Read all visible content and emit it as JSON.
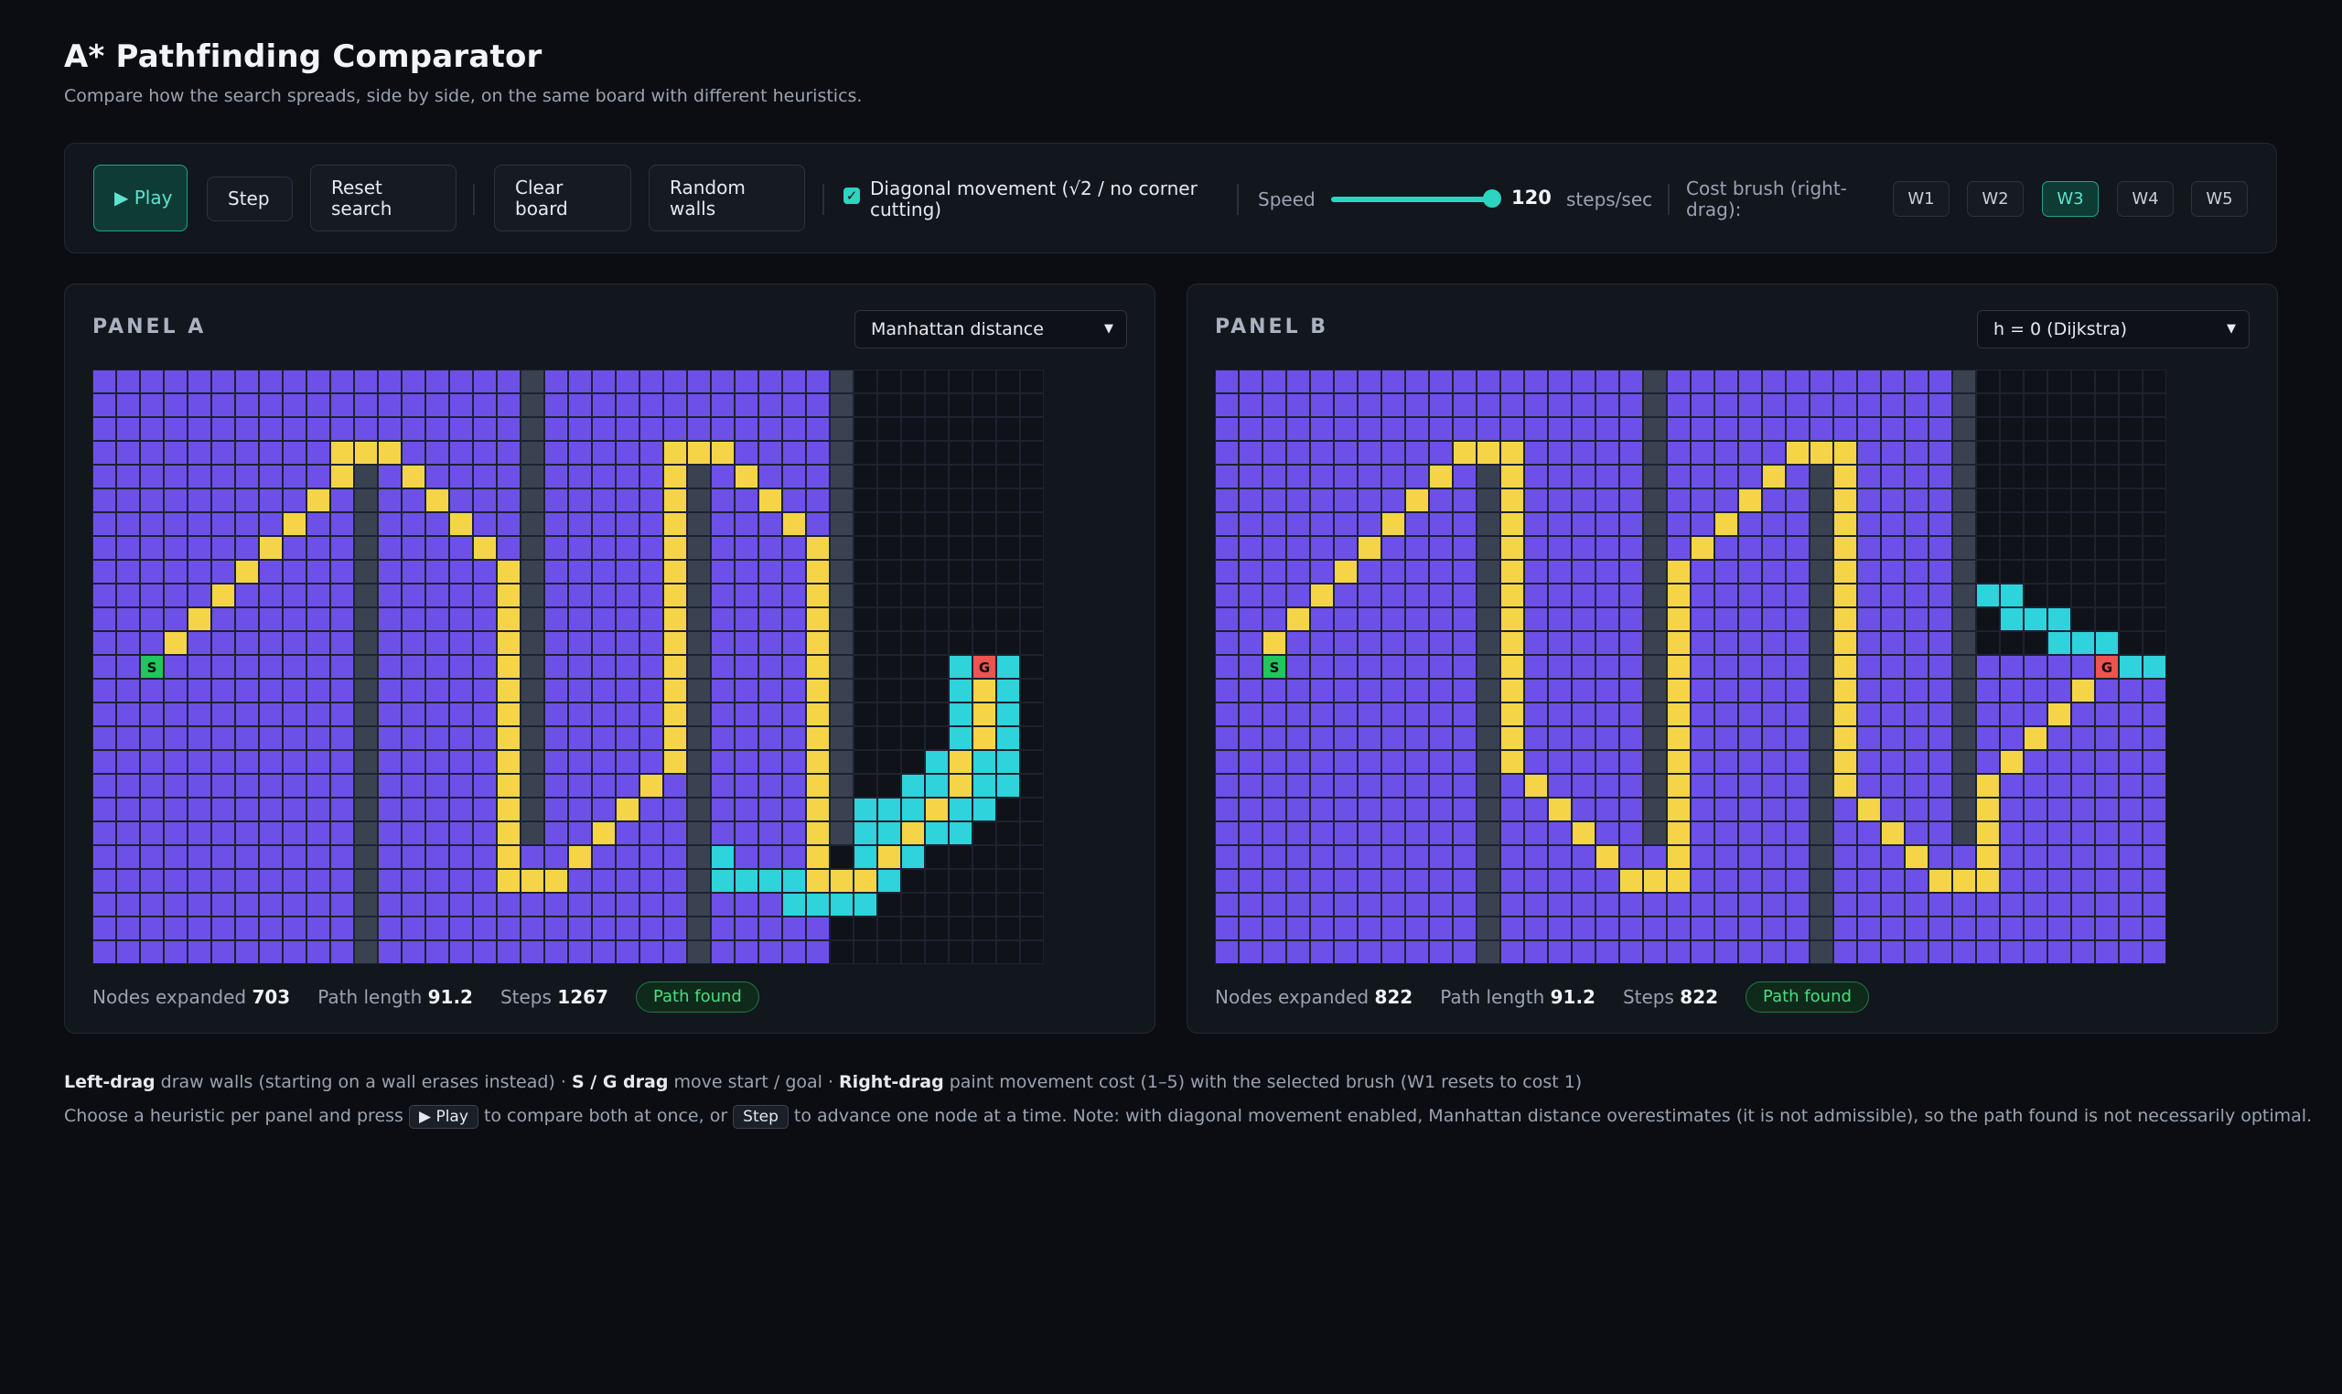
{
  "header": {
    "title": "A* Pathfinding Comparator",
    "subtitle": "Compare how the search spreads, side by side, on the same board with different heuristics."
  },
  "toolbar": {
    "play_label": "▶ Play",
    "step_label": "Step",
    "reset_label": "Reset search",
    "clear_label": "Clear board",
    "random_label": "Random walls",
    "diagonal_label": "Diagonal movement (√2 / no corner cutting)",
    "diagonal_checked": true,
    "speed_label": "Speed",
    "speed_value": "120",
    "speed_unit": "steps/sec",
    "brush_label": "Cost brush (right-drag):",
    "brushes": [
      "W1",
      "W2",
      "W3",
      "W4",
      "W5"
    ],
    "active_brush": "W3"
  },
  "colors": {
    "accent": "#2dd4bf",
    "closed": "#6d50e8",
    "open": "#2ed3dc",
    "path": "#f5d547",
    "wall": "#3a4150",
    "empty": "#0f1218",
    "start": "#22c55e",
    "goal": "#ef5350"
  },
  "grid": {
    "cols": 40,
    "rows": 25
  },
  "panels": [
    {
      "title": "PANEL A",
      "heuristic": "Manhattan distance",
      "nodes_label": "Nodes expanded",
      "nodes": "703",
      "path_label": "Path length",
      "path": "91.2",
      "steps_label": "Steps",
      "steps": "1267",
      "status": "Path found",
      "start_cell": [
        2,
        12
      ],
      "goal_cell": [
        37,
        12
      ],
      "walls": [
        [
          11,
          4,
          24
        ],
        [
          18,
          0,
          19
        ],
        [
          25,
          4,
          24
        ],
        [
          31,
          0,
          19
        ]
      ],
      "closed_full_cols": [
        0,
        30
      ],
      "closed_partial": [
        [
          31,
          0,
          1
        ]
      ],
      "path_cells": [
        [
          2,
          12
        ],
        [
          3,
          11
        ],
        [
          4,
          10
        ],
        [
          5,
          9
        ],
        [
          6,
          8
        ],
        [
          7,
          7
        ],
        [
          8,
          6
        ],
        [
          9,
          5
        ],
        [
          10,
          4
        ],
        [
          10,
          3
        ],
        [
          11,
          3
        ],
        [
          12,
          3
        ],
        [
          13,
          4
        ],
        [
          14,
          5
        ],
        [
          15,
          6
        ],
        [
          16,
          7
        ],
        [
          17,
          8
        ],
        [
          17,
          9
        ],
        [
          17,
          10
        ],
        [
          17,
          11
        ],
        [
          17,
          12
        ],
        [
          17,
          13
        ],
        [
          17,
          14
        ],
        [
          17,
          15
        ],
        [
          17,
          16
        ],
        [
          17,
          17
        ],
        [
          17,
          18
        ],
        [
          17,
          19
        ],
        [
          17,
          20
        ],
        [
          17,
          21
        ],
        [
          18,
          21
        ],
        [
          19,
          21
        ],
        [
          20,
          20
        ],
        [
          21,
          19
        ],
        [
          22,
          18
        ],
        [
          23,
          17
        ],
        [
          24,
          16
        ],
        [
          24,
          15
        ],
        [
          24,
          14
        ],
        [
          24,
          13
        ],
        [
          24,
          12
        ],
        [
          24,
          11
        ],
        [
          24,
          10
        ],
        [
          24,
          9
        ],
        [
          24,
          8
        ],
        [
          24,
          7
        ],
        [
          24,
          6
        ],
        [
          24,
          5
        ],
        [
          24,
          4
        ],
        [
          24,
          3
        ],
        [
          25,
          3
        ],
        [
          26,
          3
        ],
        [
          27,
          4
        ],
        [
          28,
          5
        ],
        [
          29,
          6
        ],
        [
          30,
          7
        ],
        [
          30,
          8
        ],
        [
          30,
          9
        ],
        [
          30,
          10
        ],
        [
          30,
          11
        ],
        [
          30,
          12
        ],
        [
          30,
          13
        ],
        [
          30,
          14
        ],
        [
          30,
          15
        ],
        [
          30,
          16
        ],
        [
          30,
          17
        ],
        [
          30,
          18
        ],
        [
          30,
          19
        ],
        [
          30,
          20
        ],
        [
          30,
          21
        ],
        [
          31,
          21
        ],
        [
          32,
          21
        ],
        [
          33,
          20
        ],
        [
          34,
          19
        ],
        [
          35,
          18
        ],
        [
          36,
          17
        ],
        [
          36,
          16
        ],
        [
          37,
          15
        ],
        [
          37,
          14
        ],
        [
          37,
          13
        ],
        [
          37,
          12
        ]
      ],
      "open_cells": [
        [
          26,
          20
        ],
        [
          26,
          21
        ],
        [
          27,
          21
        ],
        [
          28,
          21
        ],
        [
          29,
          21
        ],
        [
          29,
          22
        ],
        [
          30,
          22
        ],
        [
          31,
          22
        ],
        [
          32,
          22
        ],
        [
          33,
          21
        ],
        [
          33,
          19
        ],
        [
          32,
          20
        ],
        [
          34,
          20
        ],
        [
          35,
          19
        ],
        [
          32,
          19
        ],
        [
          33,
          18
        ],
        [
          34,
          18
        ],
        [
          35,
          17
        ],
        [
          36,
          18
        ],
        [
          36,
          19
        ],
        [
          37,
          18
        ],
        [
          38,
          17
        ],
        [
          37,
          17
        ],
        [
          38,
          16
        ],
        [
          35,
          16
        ],
        [
          36,
          15
        ],
        [
          37,
          16
        ],
        [
          36,
          14
        ],
        [
          38,
          15
        ],
        [
          36,
          13
        ],
        [
          38,
          14
        ],
        [
          36,
          12
        ],
        [
          38,
          13
        ],
        [
          38,
          12
        ],
        [
          34,
          17
        ],
        [
          32,
          18
        ]
      ],
      "empty_rule": "A"
    },
    {
      "title": "PANEL B",
      "heuristic": "h = 0 (Dijkstra)",
      "nodes_label": "Nodes expanded",
      "nodes": "822",
      "path_label": "Path length",
      "path": "91.2",
      "steps_label": "Steps",
      "steps": "822",
      "status": "Path found",
      "start_cell": [
        2,
        12
      ],
      "goal_cell": [
        37,
        12
      ],
      "walls": [
        [
          11,
          4,
          24
        ],
        [
          18,
          0,
          19
        ],
        [
          25,
          4,
          24
        ],
        [
          31,
          0,
          19
        ]
      ],
      "closed_full_cols": [
        0,
        31
      ],
      "path_cells": [
        [
          2,
          12
        ],
        [
          2,
          11
        ],
        [
          3,
          10
        ],
        [
          4,
          9
        ],
        [
          5,
          8
        ],
        [
          6,
          7
        ],
        [
          7,
          6
        ],
        [
          8,
          5
        ],
        [
          9,
          4
        ],
        [
          10,
          3
        ],
        [
          11,
          3
        ],
        [
          12,
          3
        ],
        [
          12,
          4
        ],
        [
          12,
          5
        ],
        [
          12,
          6
        ],
        [
          12,
          7
        ],
        [
          12,
          8
        ],
        [
          12,
          9
        ],
        [
          12,
          10
        ],
        [
          12,
          11
        ],
        [
          12,
          12
        ],
        [
          12,
          13
        ],
        [
          12,
          14
        ],
        [
          12,
          15
        ],
        [
          12,
          16
        ],
        [
          13,
          17
        ],
        [
          14,
          18
        ],
        [
          15,
          19
        ],
        [
          16,
          20
        ],
        [
          17,
          21
        ],
        [
          18,
          21
        ],
        [
          19,
          21
        ],
        [
          19,
          20
        ],
        [
          19,
          19
        ],
        [
          19,
          18
        ],
        [
          19,
          17
        ],
        [
          19,
          16
        ],
        [
          19,
          15
        ],
        [
          19,
          14
        ],
        [
          19,
          13
        ],
        [
          19,
          12
        ],
        [
          19,
          11
        ],
        [
          19,
          10
        ],
        [
          19,
          9
        ],
        [
          19,
          8
        ],
        [
          20,
          7
        ],
        [
          21,
          6
        ],
        [
          22,
          5
        ],
        [
          23,
          4
        ],
        [
          24,
          3
        ],
        [
          25,
          3
        ],
        [
          26,
          3
        ],
        [
          26,
          4
        ],
        [
          26,
          5
        ],
        [
          26,
          6
        ],
        [
          26,
          7
        ],
        [
          26,
          8
        ],
        [
          26,
          9
        ],
        [
          26,
          10
        ],
        [
          26,
          11
        ],
        [
          26,
          12
        ],
        [
          26,
          13
        ],
        [
          26,
          14
        ],
        [
          26,
          15
        ],
        [
          26,
          16
        ],
        [
          26,
          17
        ],
        [
          27,
          18
        ],
        [
          28,
          19
        ],
        [
          29,
          20
        ],
        [
          30,
          21
        ],
        [
          31,
          21
        ],
        [
          32,
          21
        ],
        [
          32,
          20
        ],
        [
          32,
          19
        ],
        [
          32,
          18
        ],
        [
          32,
          17
        ],
        [
          33,
          16
        ],
        [
          34,
          15
        ],
        [
          35,
          14
        ],
        [
          36,
          13
        ],
        [
          37,
          12
        ]
      ],
      "open_cells": [
        [
          32,
          9
        ],
        [
          33,
          9
        ],
        [
          33,
          10
        ],
        [
          34,
          10
        ],
        [
          35,
          10
        ],
        [
          35,
          11
        ],
        [
          36,
          11
        ],
        [
          37,
          11
        ],
        [
          38,
          12
        ],
        [
          39,
          12
        ]
      ],
      "empty_rule": "B"
    }
  ],
  "help": {
    "line1": [
      {
        "b": "Left-drag"
      },
      {
        "t": " draw walls (starting on a wall erases instead)  ·  "
      },
      {
        "b": "S / G drag"
      },
      {
        "t": " move start / goal  ·  "
      },
      {
        "b": "Right-drag"
      },
      {
        "t": " paint movement cost (1–5) with the selected brush (W1 resets to cost 1)"
      }
    ],
    "line2_a": "Choose a heuristic per panel and press ",
    "line2_kbd1": "▶ Play",
    "line2_b": " to compare both at once, or ",
    "line2_kbd2": "Step",
    "line2_c": " to advance one node at a time. Note: with diagonal movement enabled, Manhattan distance overestimates (it is not admissible), so the path found is not necessarily optimal."
  }
}
